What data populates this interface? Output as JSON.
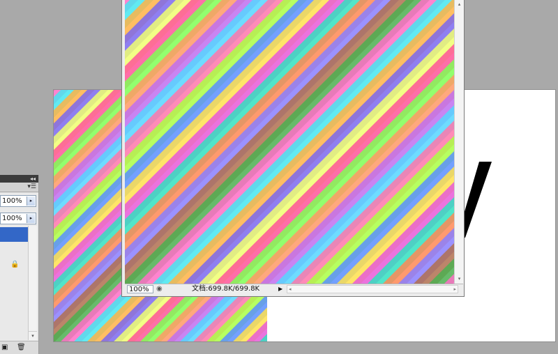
{
  "status_bar": {
    "zoom": "100%",
    "doc_info": "文档:699.8K/699.8K"
  },
  "panel": {
    "opacity_value": "100%",
    "fill_value": "100%"
  },
  "icons": {
    "status_menu": "status-menu-icon",
    "play": "play-icon",
    "scroll_left": "scroll-left-icon",
    "scroll_right": "scroll-right-icon",
    "scroll_up": "scroll-up-icon",
    "scroll_down": "scroll-down-icon",
    "lock": "lock-icon",
    "panel_menu": "panel-menu-icon",
    "collapse": "collapse-icon",
    "new_layer": "new-layer-icon",
    "trash": "trash-icon"
  },
  "colors": {
    "workspace": "#a9a9a9",
    "selection": "#3367c7",
    "stripes": [
      "#4caf50",
      "#ff6ec7",
      "#45e6f0",
      "#ffb347",
      "#7b68ee",
      "#f0ff70",
      "#ff5599",
      "#7fff55",
      "#ff9966",
      "#c06ef0",
      "#55d6ff",
      "#ff77aa",
      "#aaff44",
      "#5a8fff",
      "#ffe04d",
      "#e85bd8",
      "#33e0c0",
      "#ff8855",
      "#8a7fff",
      "#b07050"
    ]
  }
}
